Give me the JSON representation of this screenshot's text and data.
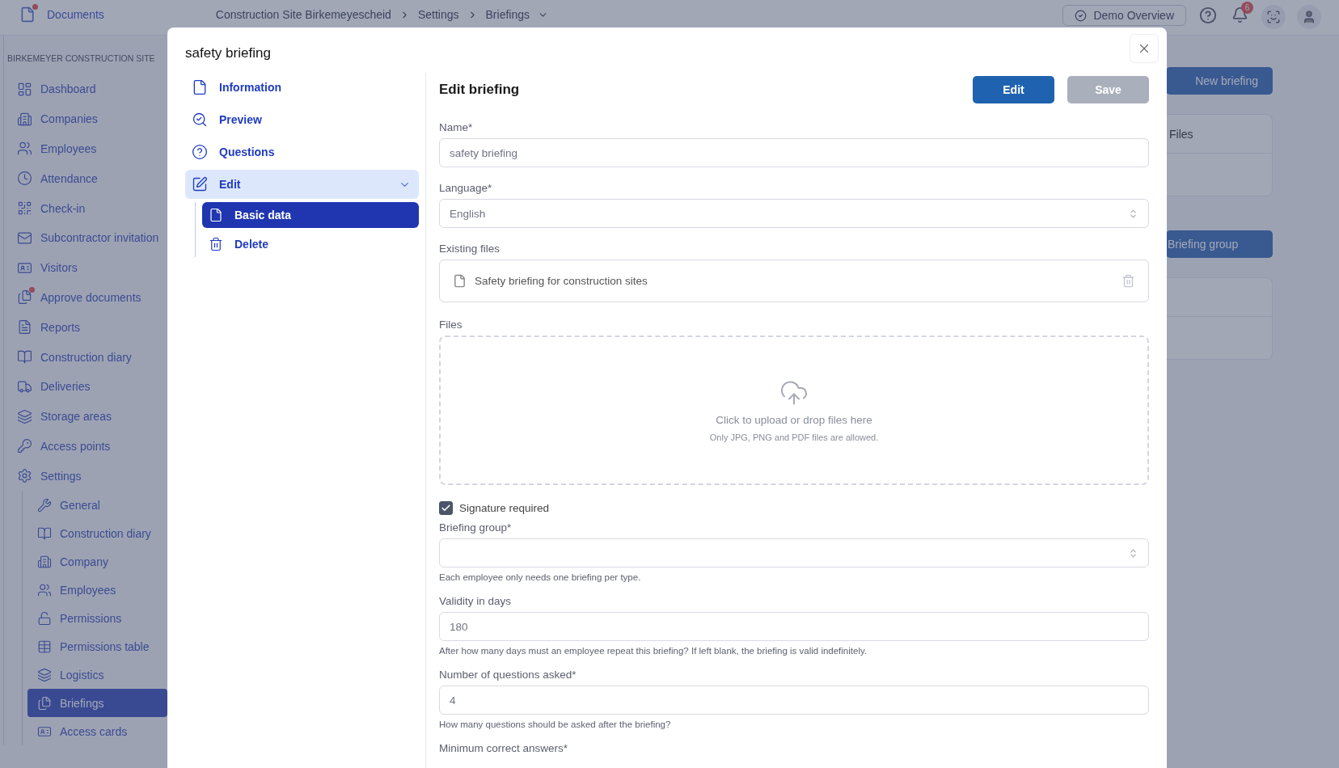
{
  "top_bar": {
    "title": "Documents",
    "dot": true,
    "breadcrumb": [
      "Construction Site Birkemeyescheid",
      "Settings",
      "Briefings"
    ],
    "demo_button": "Demo Overview",
    "notification_count": "6"
  },
  "sidebar": {
    "section_title": "BIRKEMEYER CONSTRUCTION SITE",
    "items": [
      {
        "label": "Dashboard",
        "dot": false,
        "selected": false
      },
      {
        "label": "Companies",
        "dot": false,
        "selected": false
      },
      {
        "label": "Employees",
        "dot": false,
        "selected": false
      },
      {
        "label": "Attendance",
        "dot": false,
        "selected": false
      },
      {
        "label": "Check-in",
        "dot": false,
        "selected": false
      },
      {
        "label": "Subcontractor invitation",
        "dot": false,
        "selected": false
      },
      {
        "label": "Visitors",
        "dot": false,
        "selected": false
      },
      {
        "label": "Approve documents",
        "dot": true,
        "selected": false
      },
      {
        "label": "Reports",
        "dot": false,
        "selected": false
      },
      {
        "label": "Construction diary",
        "dot": false,
        "selected": false
      },
      {
        "label": "Deliveries",
        "dot": false,
        "selected": false
      },
      {
        "label": "Storage areas",
        "dot": false,
        "selected": false
      },
      {
        "label": "Access points",
        "dot": false,
        "selected": false
      },
      {
        "label": "Settings",
        "dot": false,
        "selected": false,
        "children": [
          {
            "label": "General",
            "selected": false
          },
          {
            "label": "Construction diary",
            "selected": false
          },
          {
            "label": "Company",
            "selected": false
          },
          {
            "label": "Employees",
            "selected": false
          },
          {
            "label": "Permissions",
            "selected": false
          },
          {
            "label": "Permissions table",
            "selected": false
          },
          {
            "label": "Logistics",
            "selected": false
          },
          {
            "label": "Briefings",
            "selected": true
          },
          {
            "label": "Access cards",
            "selected": false
          }
        ]
      }
    ]
  },
  "background": {
    "new_button": "New briefing",
    "files_card_title": "Files",
    "group_button": "Briefing group"
  },
  "modal": {
    "title": "safety briefing",
    "nav": [
      {
        "label": "Information",
        "selected": false
      },
      {
        "label": "Preview",
        "selected": false
      },
      {
        "label": "Questions",
        "selected": false
      },
      {
        "label": "Edit",
        "selected": true,
        "expanded": true,
        "children": [
          {
            "label": "Basic data",
            "selected": true
          },
          {
            "label": "Delete",
            "selected": false
          }
        ]
      }
    ],
    "form": {
      "heading": "Edit briefing",
      "disabled": true,
      "buttons": [
        {
          "label": "Edit",
          "disabled": false
        },
        {
          "label": "Save",
          "disabled": true
        }
      ],
      "fields": [
        {
          "kind": "text",
          "label": "Name*",
          "value": "safety briefing"
        },
        {
          "kind": "select",
          "label": "Language*",
          "value": "English"
        },
        {
          "kind": "files",
          "label": "Existing files",
          "files": [
            "Safety briefing for construction sites"
          ]
        },
        {
          "kind": "dropzone",
          "label": "Files",
          "prompt": "Click to upload or drop files here",
          "note": "Only JPG, PNG and PDF files are allowed."
        },
        {
          "kind": "checkbox",
          "label": "Signature required",
          "checked": true
        },
        {
          "kind": "select",
          "label": "Briefing group*",
          "hint": "Each employee only needs one briefing per type."
        },
        {
          "kind": "text",
          "label": "Validity in days",
          "value": "180",
          "hint": "After how many days must an employee repeat this briefing? If left blank, the briefing is valid indefinitely."
        },
        {
          "kind": "text",
          "label": "Number of questions asked*",
          "value": "4",
          "hint": "How many questions should be asked after the briefing?"
        },
        {
          "kind": "label",
          "label": "Minimum correct answers*"
        }
      ]
    }
  }
}
